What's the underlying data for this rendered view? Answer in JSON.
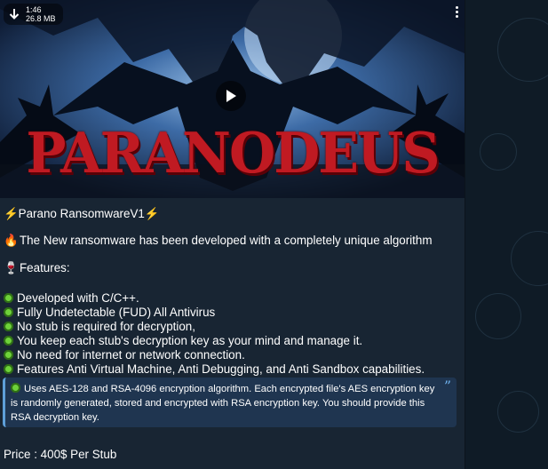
{
  "video": {
    "duration": "1:46",
    "size": "26.8 MB",
    "title_art": "PARANODEUS",
    "icons": [
      "download-icon",
      "more-icon",
      "play-icon"
    ]
  },
  "message": {
    "heading": "⚡Parano RansomwareV1⚡",
    "intro_emoji": "🔥",
    "intro": "The New ransomware has been developed with a completely unique algorithm",
    "features_emoji": "🍷",
    "features_label": "Features:",
    "features": [
      "Developed with C/C++.",
      "Fully Undetectable (FUD) All Antivirus",
      "No stub is required for decryption,",
      "You keep each stub's decryption key as your mind and manage it.",
      "No need for internet or network connection.",
      "Features Anti Virtual Machine, Anti Debugging, and Anti Sandbox capabilities."
    ],
    "quote": "Uses AES-128 and RSA-4096 encryption algorithm. Each encrypted file's AES encryption key is randomly generated, stored and encrypted with RSA encryption key. You should provide this RSA decryption key.",
    "quote_mark": "”",
    "price": "Price : 400$ Per Stub"
  },
  "colors": {
    "app_bg": "#0e1621",
    "bubble_bg": "#182533",
    "quote_bg": "#1f3550",
    "quote_accent": "#5e9fd8",
    "title_red": "#c01a22",
    "text": "#ffffff"
  }
}
